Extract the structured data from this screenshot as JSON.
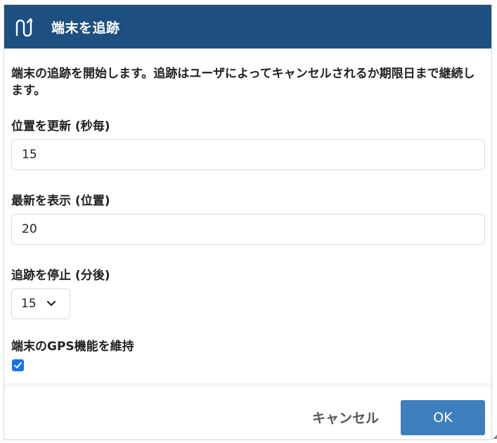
{
  "dialog": {
    "title": "端末を追跡",
    "icon": "u-turn-up-icon",
    "description": "端末の追跡を開始します。追跡はユーザによってキャンセルされるか期限日まで継続します。"
  },
  "fields": {
    "update_interval": {
      "label": "位置を更新 (秒毎)",
      "value": "15"
    },
    "show_latest": {
      "label": "最新を表示 (位置)",
      "value": "20"
    },
    "stop_tracking": {
      "label": "追跡を停止 (分後)",
      "selected": "15"
    },
    "keep_gps": {
      "label": "端末のGPS機能を維持",
      "checked": true
    }
  },
  "buttons": {
    "cancel": "キャンセル",
    "ok": "OK"
  },
  "colors": {
    "header_bg": "#1d4f80",
    "primary_button": "#3d7fbd",
    "checkbox": "#1a73e8"
  }
}
